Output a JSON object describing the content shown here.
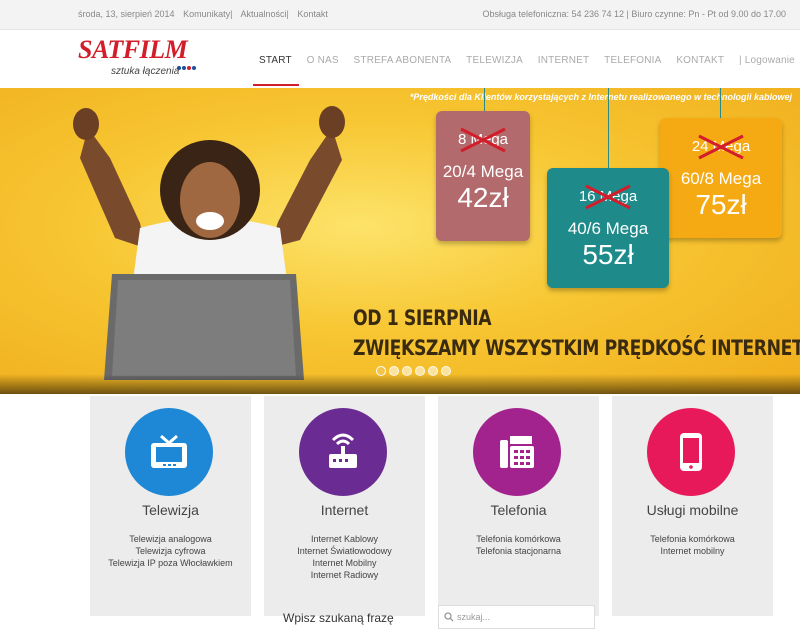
{
  "topbar": {
    "date": "środa, 13, sierpień 2014",
    "links": [
      "Komunikaty",
      "Aktualności",
      "Kontakt"
    ],
    "contact": "Obsługa telefoniczna: 54 236 74 12 | Biuro czynne: Pn - Pt od 9.00 do 17.00"
  },
  "logo": {
    "brand": "SATFILM",
    "tagline": "sztuka łączenia",
    "dot_colors": [
      "#1b4fa0",
      "#1b4fa0",
      "#d21d2a",
      "#1b4fa0"
    ]
  },
  "nav": {
    "items": [
      "START",
      "O NAS",
      "STREFA ABONENTA",
      "TELEWIZJA",
      "INTERNET",
      "TELEFONIA",
      "KONTAKT",
      "| Logowanie"
    ],
    "active": "START",
    "accent": "#d21d2a"
  },
  "hero": {
    "note": "*Prędkości dla Klientów korzystających z Internetu realizowanego w technologii kablowej",
    "offers": [
      {
        "old": "8 Mega",
        "new": "20/4 Mega",
        "price": "42zł",
        "color": "#b36a6c"
      },
      {
        "old": "16 Mega",
        "new": "40/6 Mega",
        "price": "55zł",
        "color": "#1f8a8a"
      },
      {
        "old": "24 Mega",
        "new": "60/8 Mega",
        "price": "75zł",
        "color": "#f5a912"
      }
    ],
    "slogan_line1": "OD 1 SIERPNIA",
    "slogan_line2": "ZWIĘKSZAMY WSZYSTKIM PRĘDKOŚĆ INTERNETU !",
    "slide_count": 6,
    "active_slide": 1
  },
  "services": [
    {
      "title": "Telewizja",
      "color": "#1e88d6",
      "icon": "tv-icon",
      "links": [
        "Telewizja analogowa",
        "Telewizja cyfrowa",
        "Telewizja IP poza Włocławkiem"
      ]
    },
    {
      "title": "Internet",
      "color": "#6a2b92",
      "icon": "router-icon",
      "links": [
        "Internet Kablowy",
        "Internet Światłowodowy",
        "Internet Mobilny",
        "Internet Radiowy"
      ]
    },
    {
      "title": "Telefonia",
      "color": "#a3238e",
      "icon": "fax-phone-icon",
      "links": [
        "Telefonia komórkowa",
        "Telefonia stacjonarna"
      ]
    },
    {
      "title": "Usługi mobilne",
      "color": "#e8195a",
      "icon": "mobile-phone-icon",
      "links": [
        "Telefonia komórkowa",
        "Internet mobilny"
      ]
    }
  ],
  "search": {
    "label": "Wpisz szukaną frazę",
    "placeholder": "szukaj..."
  }
}
